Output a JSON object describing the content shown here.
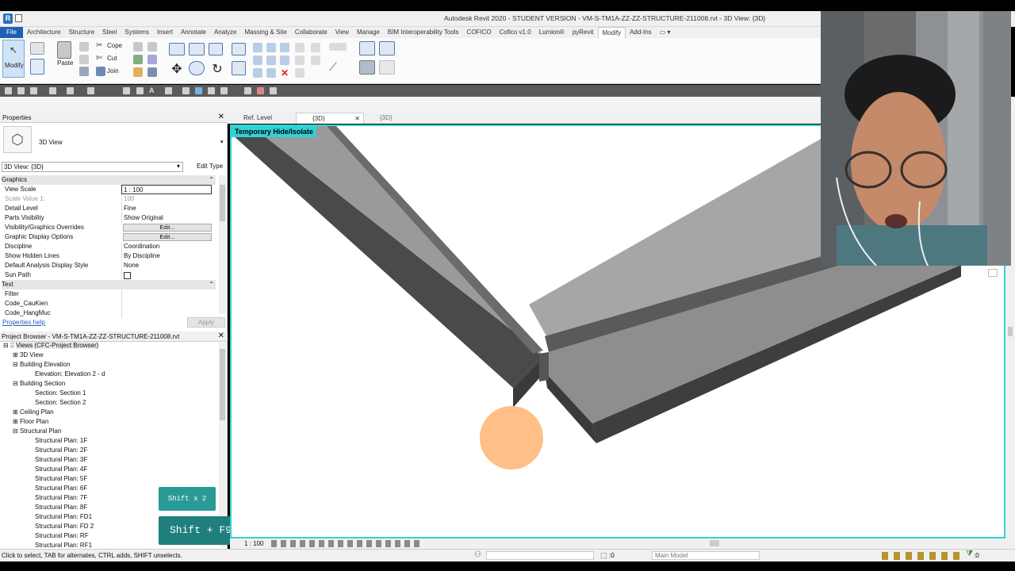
{
  "window": {
    "title": "Autodesk Revit 2020 - STUDENT VERSION - VM-S-TM1A-ZZ-ZZ-STRUCTURE-211008.rvt - 3D View: {3D}"
  },
  "menu": [
    "File",
    "Architecture",
    "Structure",
    "Steel",
    "Systems",
    "Insert",
    "Annotate",
    "Analyze",
    "Massing & Site",
    "Collaborate",
    "View",
    "Manage",
    "BIM Interoperability Tools",
    "COFICO",
    "Cofico v1.0",
    "Lumion®",
    "pyRevit",
    "Modify",
    "Add-Ins"
  ],
  "ribbon": {
    "modify": "Modify",
    "paste": "Paste",
    "cope": "Cope",
    "cut": "Cut",
    "join": "Join"
  },
  "view_tabs": [
    {
      "label": "Ref. Level"
    },
    {
      "label": "{3D}",
      "active": true
    },
    {
      "label": "{3D}"
    }
  ],
  "properties": {
    "title": "Properties",
    "type_name": "3D View",
    "selector": "3D View: {3D}",
    "edit_type": "Edit Type",
    "groups": {
      "graphics": "Graphics",
      "text": "Text"
    },
    "rows": [
      {
        "key": "View Scale",
        "value": "1 : 100"
      },
      {
        "key": "Scale Value    1:",
        "value": "100"
      },
      {
        "key": "Detail Level",
        "value": "Fine"
      },
      {
        "key": "Parts Visibility",
        "value": "Show Original"
      },
      {
        "key": "Visibility/Graphics Overrides",
        "value": "Edit..."
      },
      {
        "key": "Graphic Display Options",
        "value": "Edit..."
      },
      {
        "key": "Discipline",
        "value": "Coordination"
      },
      {
        "key": "Show Hidden Lines",
        "value": "By Discipline"
      },
      {
        "key": "Default Analysis Display Style",
        "value": "None"
      },
      {
        "key": "Sun Path",
        "value": ""
      }
    ],
    "text_rows": [
      {
        "key": "Filter",
        "value": ""
      },
      {
        "key": "Code_CauKien",
        "value": ""
      },
      {
        "key": "Code_HangMuc",
        "value": ""
      }
    ],
    "help": "Properties help",
    "apply": "Apply"
  },
  "browser": {
    "title": "Project Browser - VM-S-TM1A-ZZ-ZZ-STRUCTURE-211008.rvt",
    "root": "Views (CFC-Project Browser)",
    "nodes": [
      {
        "label": "3D View",
        "level": 1
      },
      {
        "label": "Building Elevation",
        "level": 1
      },
      {
        "label": "Elevation: Elevation 2 - d",
        "level": 2
      },
      {
        "label": "Building Section",
        "level": 1
      },
      {
        "label": "Section: Section 1",
        "level": 2
      },
      {
        "label": "Section: Section 2",
        "level": 2
      },
      {
        "label": "Ceiling Plan",
        "level": 1
      },
      {
        "label": "Floor Plan",
        "level": 1
      },
      {
        "label": "Structural Plan",
        "level": 1
      },
      {
        "label": "Structural Plan: 1F",
        "level": 2
      },
      {
        "label": "Structural Plan: 2F",
        "level": 2
      },
      {
        "label": "Structural Plan: 3F",
        "level": 2
      },
      {
        "label": "Structural Plan: 4F",
        "level": 2
      },
      {
        "label": "Structural Plan: 5F",
        "level": 2
      },
      {
        "label": "Structural Plan: 6F",
        "level": 2
      },
      {
        "label": "Structural Plan: 7F",
        "level": 2
      },
      {
        "label": "Structural Plan: 8F",
        "level": 2
      },
      {
        "label": "Structural Plan: FD1",
        "level": 2
      },
      {
        "label": "Structural Plan: FD 2",
        "level": 2
      },
      {
        "label": "Structural Plan: RF",
        "level": 2
      },
      {
        "label": "Structural Plan: RF1",
        "level": 2
      }
    ]
  },
  "viewport": {
    "temp_label": "Temporary Hide/Isolate",
    "scale": "1 : 100"
  },
  "keys": {
    "first": "Shift x 2",
    "second": "Shift + F9"
  },
  "status": {
    "text": "Click to select, TAB for alternates, CTRL adds, SHIFT unselects.",
    "zero": ":0",
    "model": "Main Model",
    "filter": ":0"
  },
  "colors": {
    "accent": "#33d1d6",
    "file": "#1f5fb4",
    "cursor": "#ffbf87",
    "key": "#2a9a96"
  }
}
